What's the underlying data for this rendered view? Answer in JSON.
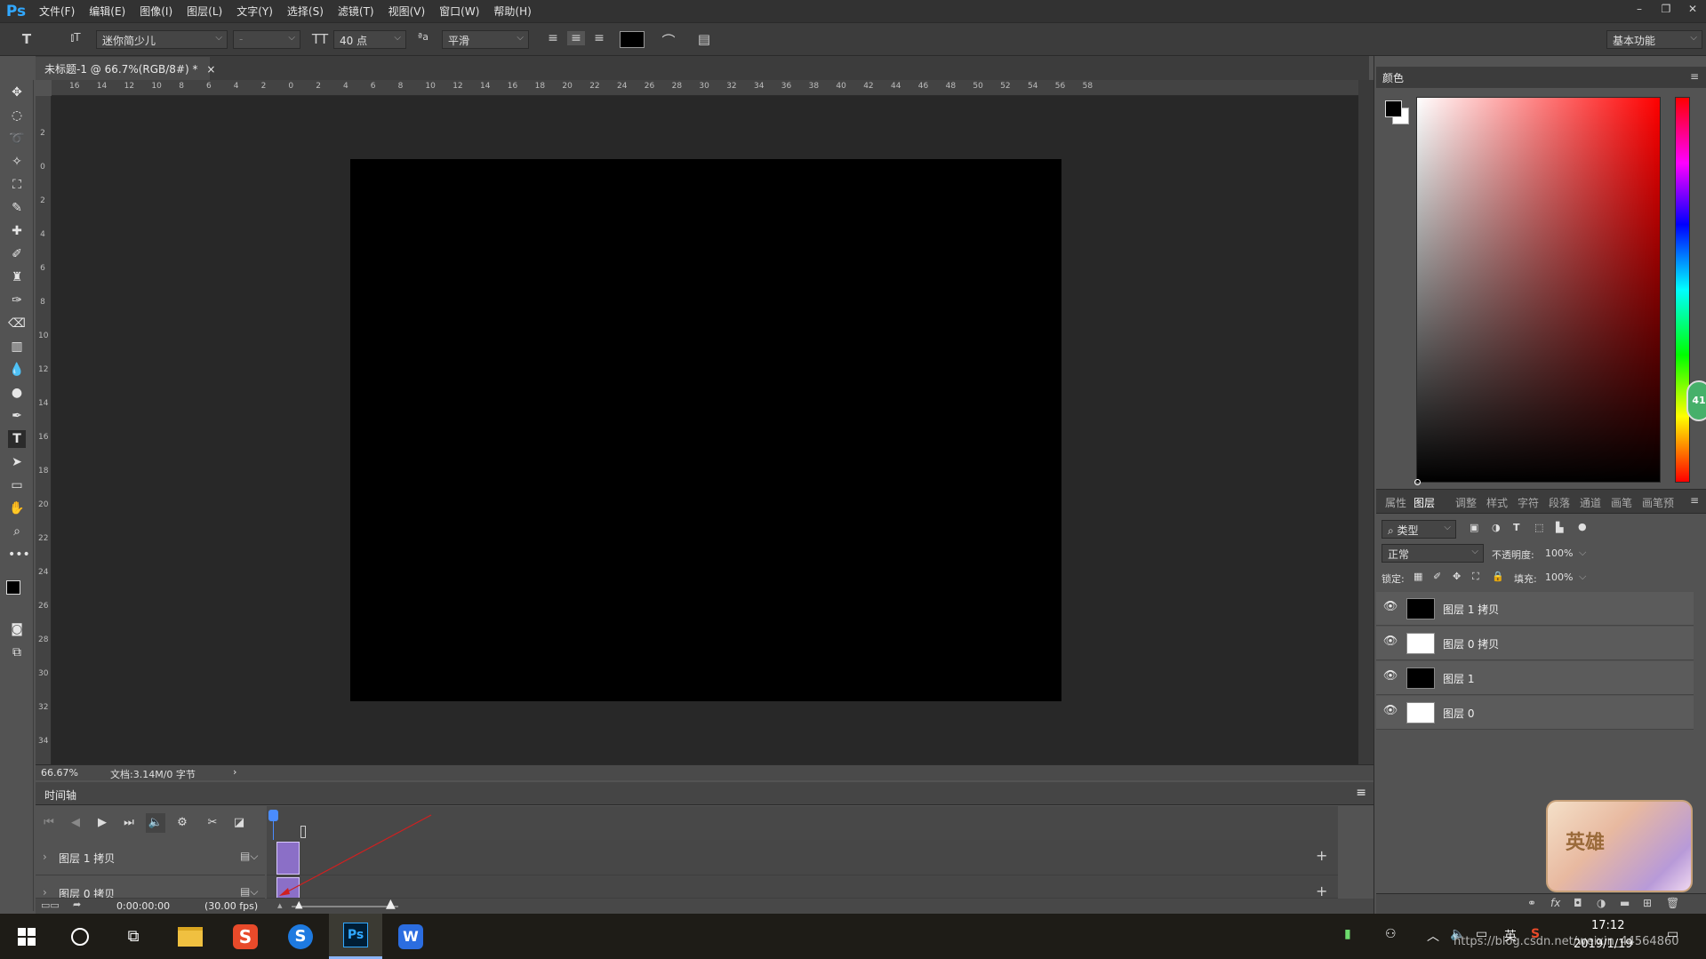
{
  "app": {
    "logo": "Ps",
    "accent": "#31a8ff"
  },
  "menu": {
    "items": [
      "文件(F)",
      "编辑(E)",
      "图像(I)",
      "图层(L)",
      "文字(Y)",
      "选择(S)",
      "滤镜(T)",
      "视图(V)",
      "窗口(W)",
      "帮助(H)"
    ]
  },
  "window_controls": {
    "minimize": "–",
    "restore": "❐",
    "close": "✕"
  },
  "options": {
    "tool_icon": "T",
    "font_family": "迷你简少儿",
    "font_style": "-",
    "font_size": "40 点",
    "aa_icon": "ªa",
    "antialias": "平滑",
    "text_color": "#000000",
    "workspace": "基本功能"
  },
  "document": {
    "tab_title": "未标题-1 @ 66.7%(RGB/8#) *",
    "close": "×",
    "canvas_color": "#000000",
    "ruler_top_ticks": [
      "16",
      "14",
      "12",
      "10",
      "8",
      "6",
      "4",
      "2",
      "0",
      "2",
      "4",
      "6",
      "8",
      "10",
      "12",
      "14",
      "16",
      "18",
      "20",
      "22",
      "24",
      "26",
      "28",
      "30",
      "32",
      "34",
      "36",
      "38",
      "40",
      "42",
      "44",
      "46",
      "48",
      "50",
      "52",
      "54",
      "56",
      "58"
    ],
    "ruler_left_ticks": [
      "2",
      "0",
      "2",
      "4",
      "6",
      "8",
      "10",
      "12",
      "14",
      "16",
      "18",
      "20",
      "22",
      "24",
      "26",
      "28",
      "30",
      "32",
      "34"
    ],
    "zoom": "66.67%",
    "doc_info": "文档:3.14M/0 字节",
    "status_arrow": "›"
  },
  "timeline": {
    "title": "时间轴",
    "menu_icon": "≡",
    "layers": [
      {
        "name": "图层 1 拷贝"
      },
      {
        "name": "图层 0 拷贝"
      }
    ],
    "time": "0:00:00:00",
    "fps": "(30.00 fps)",
    "add": "+"
  },
  "color_panel": {
    "title": "颜色",
    "hue_value": "41"
  },
  "layers_panel": {
    "tabs": [
      "属性",
      "图层",
      "调整",
      "样式",
      "字符",
      "段落",
      "通道",
      "画笔",
      "画笔预"
    ],
    "active_tab": "图层",
    "filter_kind": "类型",
    "blend_mode": "正常",
    "opacity_label": "不透明度:",
    "opacity": "100%",
    "lock_label": "锁定:",
    "fill_label": "填充:",
    "fill": "100%",
    "layers": [
      {
        "name": "图层 1 拷贝",
        "thumb": "#000000"
      },
      {
        "name": "图层 0 拷贝",
        "thumb": "#ffffff"
      },
      {
        "name": "图层 1",
        "thumb": "#000000"
      },
      {
        "name": "图层 0",
        "thumb": "#ffffff"
      }
    ]
  },
  "sticker": {
    "text": "英雄"
  },
  "taskbar": {
    "time": "17:12",
    "date": "2019/1/19",
    "ime": "英",
    "watermark": "https://blog.csdn.net/weixin_44564860"
  }
}
